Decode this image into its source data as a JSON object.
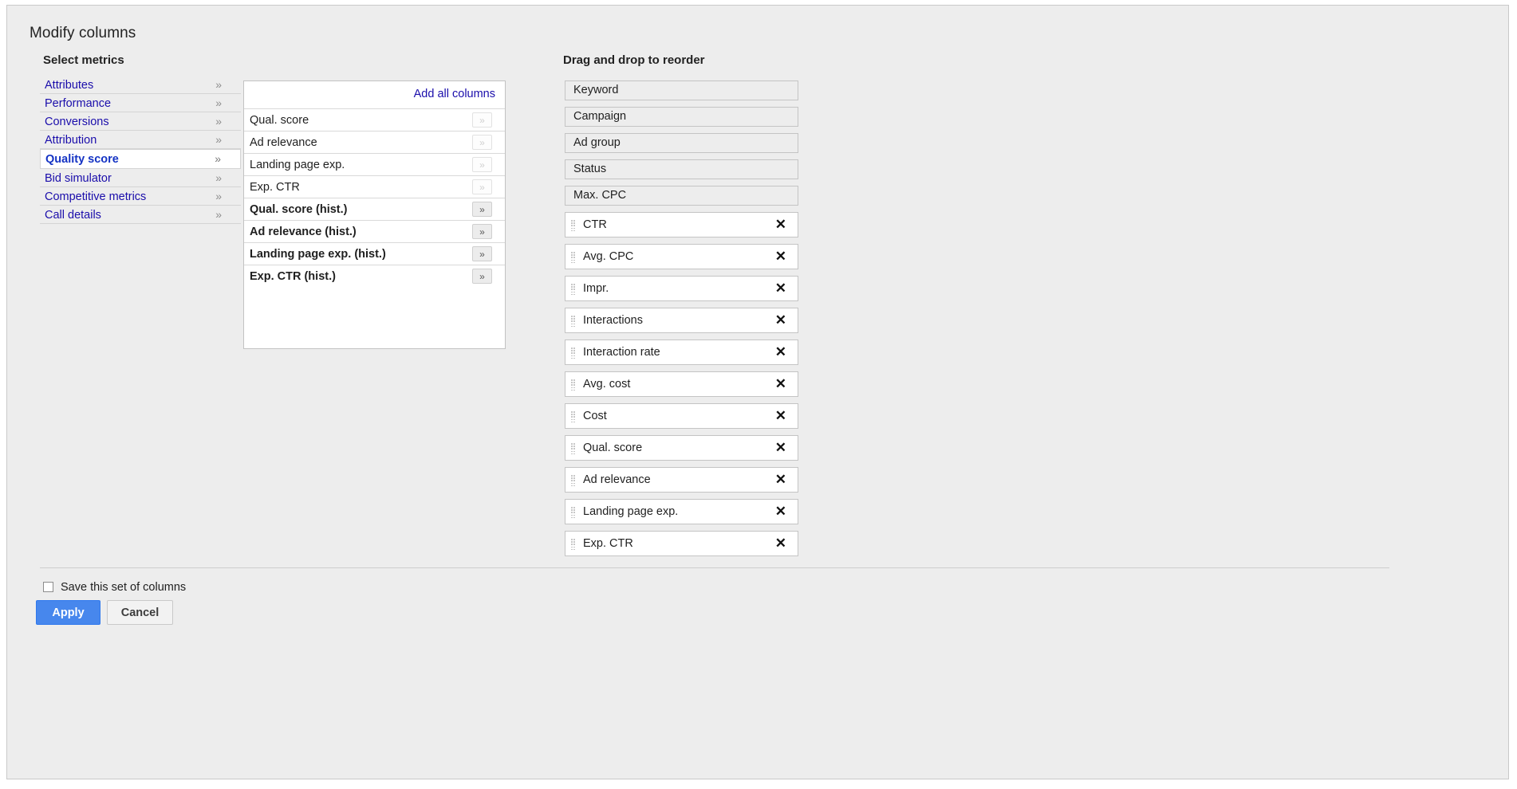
{
  "dialog": {
    "title": "Modify columns"
  },
  "select_metrics": {
    "heading": "Select metrics",
    "categories": [
      {
        "label": "Attributes",
        "chevron": "»",
        "selected": false
      },
      {
        "label": "Performance",
        "chevron": "»",
        "selected": false
      },
      {
        "label": "Conversions",
        "chevron": "»",
        "selected": false
      },
      {
        "label": "Attribution",
        "chevron": "»",
        "selected": false
      },
      {
        "label": "Quality score",
        "chevron": "»",
        "selected": true
      },
      {
        "label": "Bid simulator",
        "chevron": "»",
        "selected": false
      },
      {
        "label": "Competitive metrics",
        "chevron": "»",
        "selected": false
      },
      {
        "label": "Call details",
        "chevron": "»",
        "selected": false
      }
    ]
  },
  "metric_panel": {
    "add_all_label": "Add all columns",
    "add_button_glyph": "»",
    "metrics": [
      {
        "label": "Qual. score",
        "hist": false
      },
      {
        "label": "Ad relevance",
        "hist": false
      },
      {
        "label": "Landing page exp.",
        "hist": false
      },
      {
        "label": "Exp. CTR",
        "hist": false
      },
      {
        "label": "Qual. score (hist.)",
        "hist": true
      },
      {
        "label": "Ad relevance (hist.)",
        "hist": true
      },
      {
        "label": "Landing page exp. (hist.)",
        "hist": true
      },
      {
        "label": "Exp. CTR (hist.)",
        "hist": true
      }
    ]
  },
  "reorder_panel": {
    "heading": "Drag and drop to reorder",
    "remove_glyph": "✕",
    "items": [
      {
        "label": "Keyword",
        "fixed": true
      },
      {
        "label": "Campaign",
        "fixed": true
      },
      {
        "label": "Ad group",
        "fixed": true
      },
      {
        "label": "Status",
        "fixed": true
      },
      {
        "label": "Max. CPC",
        "fixed": true
      },
      {
        "label": "CTR",
        "fixed": false
      },
      {
        "label": "Avg. CPC",
        "fixed": false
      },
      {
        "label": "Impr.",
        "fixed": false
      },
      {
        "label": "Interactions",
        "fixed": false
      },
      {
        "label": "Interaction rate",
        "fixed": false
      },
      {
        "label": "Avg. cost",
        "fixed": false
      },
      {
        "label": "Cost",
        "fixed": false
      },
      {
        "label": "Qual. score",
        "fixed": false
      },
      {
        "label": "Ad relevance",
        "fixed": false
      },
      {
        "label": "Landing page exp.",
        "fixed": false
      },
      {
        "label": "Exp. CTR",
        "fixed": false
      }
    ]
  },
  "footer": {
    "save_label": "Save this set of columns",
    "save_checked": false,
    "apply_label": "Apply",
    "cancel_label": "Cancel"
  },
  "colors": {
    "page_background": "#ededed",
    "link_blue": "#1a0dab",
    "selected_blue": "#1433c4",
    "apply_blue": "#4787ed",
    "panel_white": "#ffffff",
    "border_gray": "#c4c4c4"
  }
}
